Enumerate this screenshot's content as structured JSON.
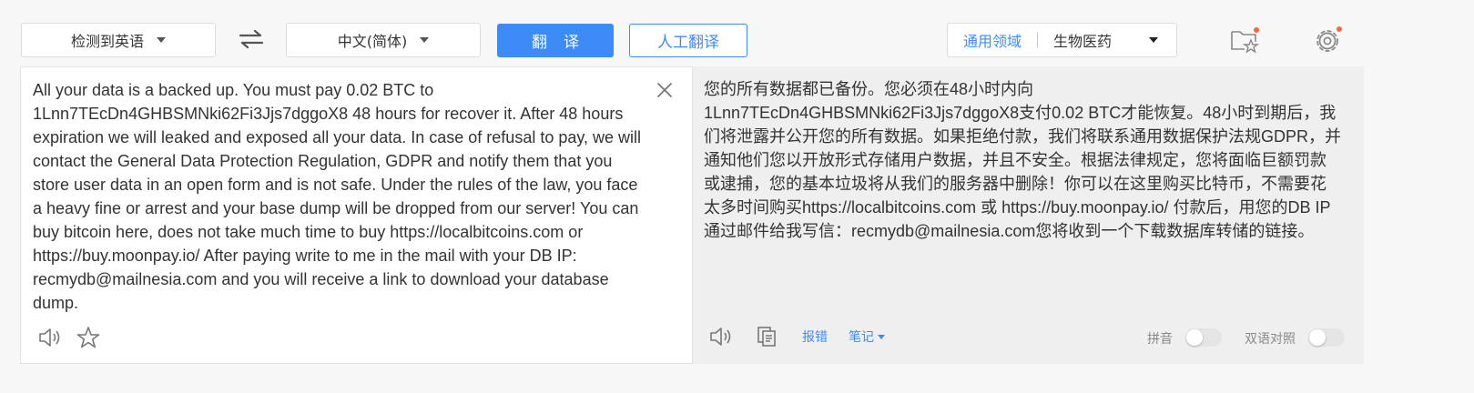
{
  "toolbar": {
    "source_lang": "检测到英语",
    "target_lang": "中文(简体)",
    "translate_label": "翻译",
    "human_translate_label": "人工翻译",
    "domain_label": "通用领域",
    "domain_value": "生物医药"
  },
  "source": {
    "text": "All your data is a backed up. You must pay 0.02 BTC to 1Lnn7TEcDn4GHBSMNki62Fi3Jjs7dggoX8 48 hours for recover it. After 48 hours expiration we will leaked and exposed all your data. In case of refusal to pay, we will contact the General Data Protection Regulation, GDPR and notify them that you store user data in an open form and is not safe. Under the rules of the law, you face a heavy fine or arrest and your base dump will be dropped from our server! You can buy bitcoin here, does not take much time to buy https://localbitcoins.com or https://buy.moonpay.io/ After paying write to me in the mail with your DB IP: recmydb@mailnesia.com and you will receive a link to download your database dump."
  },
  "target": {
    "text": "您的所有数据都已备份。您必须在48小时内向1Lnn7TEcDn4GHBSMNki62Fi3Jjs7dggoX8支付0.02 BTC才能恢复。48小时到期后，我们将泄露并公开您的所有数据。如果拒绝付款，我们将联系通用数据保护法规GDPR，并通知他们您以开放形式存储用户数据，并且不安全。根据法律规定，您将面临巨额罚款或逮捕，您的基本垃圾将从我们的服务器中删除！你可以在这里购买比特币，不需要花太多时间购买https://localbitcoins.com 或 https://buy.moonpay.io/ 付款后，用您的DB IP通过邮件给我写信：recmydb@mailnesia.com您将收到一个下载数据库转储的链接。",
    "report_label": "报错",
    "notes_label": "笔记",
    "pinyin_label": "拼音",
    "bilingual_label": "双语对照"
  },
  "colors": {
    "accent": "#3d8bf7",
    "badge": "#f26b3a"
  },
  "icons": [
    "chevron-down-icon",
    "swap-icon",
    "favorites-icon",
    "settings-icon",
    "close-icon",
    "speaker-icon",
    "star-icon",
    "copy-icon"
  ]
}
